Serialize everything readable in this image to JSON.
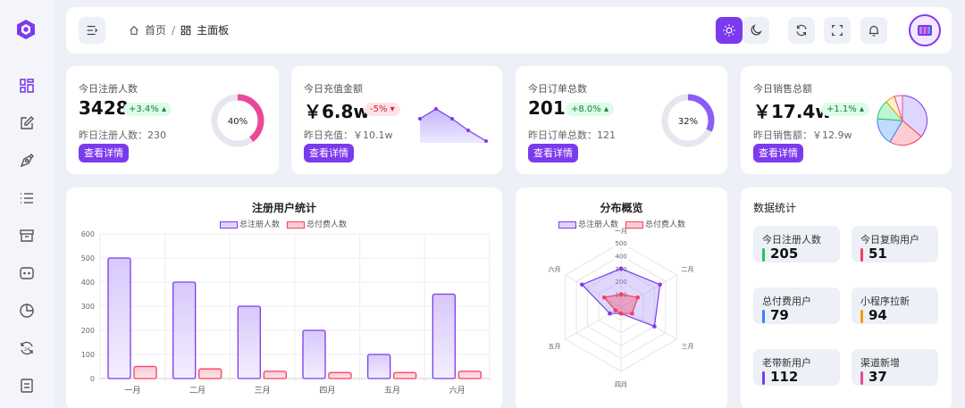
{
  "breadcrumb": {
    "home": "首页",
    "separator": "/",
    "current": "主面板"
  },
  "sidebar": {
    "items": [
      {
        "icon": "dashboard-icon"
      },
      {
        "icon": "edit-icon"
      },
      {
        "icon": "pen-icon"
      },
      {
        "icon": "list-icon"
      },
      {
        "icon": "archive-icon"
      },
      {
        "icon": "chat-icon"
      },
      {
        "icon": "pie-icon"
      },
      {
        "icon": "refresh24-icon"
      },
      {
        "icon": "document-icon"
      }
    ]
  },
  "colors": {
    "primary": "#7c3aed",
    "pink": "#f43f5e",
    "green": "#22c55e",
    "blue": "#3b82f6",
    "yellow": "#f59e0b"
  },
  "stats": [
    {
      "title": "今日注册人数",
      "value": "3428",
      "badge": "+3.4%",
      "badge_type": "up",
      "sub": "昨日注册人数：230",
      "button": "查看详情",
      "ring_label": "40%",
      "ring_percent": 40
    },
    {
      "title": "今日充值金额",
      "value": "￥6.8w",
      "badge": "-5%",
      "badge_type": "down",
      "sub": "昨日充值：￥10.1w",
      "button": "查看详情"
    },
    {
      "title": "今日订单总数",
      "value": "201",
      "badge": "+8.0%",
      "badge_type": "up",
      "sub": "昨日订单总数：121",
      "button": "查看详情",
      "ring_label": "32%",
      "ring_percent": 32
    },
    {
      "title": "今日销售总额",
      "value": "￥17.4w",
      "badge": "+1.1%",
      "badge_type": "up",
      "sub": "昨日销售额：￥12.9w",
      "button": "查看详情"
    }
  ],
  "chart_data": [
    {
      "type": "bar",
      "title": "注册用户统计",
      "categories": [
        "一月",
        "二月",
        "三月",
        "四月",
        "五月",
        "六月"
      ],
      "series": [
        {
          "name": "总注册人数",
          "values": [
            500,
            400,
            300,
            200,
            100,
            350
          ],
          "color": "#7c3aed"
        },
        {
          "name": "总付费人数",
          "values": [
            50,
            40,
            30,
            25,
            25,
            30
          ],
          "color": "#f43f5e"
        }
      ],
      "ylim": [
        0,
        600
      ],
      "yticks": [
        0,
        100,
        200,
        300,
        400,
        500,
        600
      ],
      "grid": true,
      "legend": "top"
    },
    {
      "type": "radar",
      "title": "分布概览",
      "axes": [
        "一月",
        "二月",
        "三月",
        "四月",
        "五月",
        "六月"
      ],
      "series": [
        {
          "name": "总注册人数",
          "values": [
            300,
            350,
            300,
            50,
            100,
            350
          ],
          "color": "#7c3aed"
        },
        {
          "name": "总付费人数",
          "values": [
            100,
            150,
            100,
            50,
            50,
            150
          ],
          "color": "#f43f5e"
        }
      ],
      "rlim": [
        0,
        500
      ],
      "rticks": [
        100,
        200,
        300,
        400,
        500
      ],
      "legend": "top"
    }
  ],
  "data_stats": {
    "title": "数据统计",
    "tiles": [
      {
        "label": "今日注册人数",
        "value": "205",
        "color": "#22c55e"
      },
      {
        "label": "今日复购用户",
        "value": "51",
        "color": "#f43f5e"
      },
      {
        "label": "总付费用户",
        "value": "79",
        "color": "#3b82f6"
      },
      {
        "label": "小程序拉新",
        "value": "94",
        "color": "#f59e0b"
      },
      {
        "label": "老带新用户",
        "value": "112",
        "color": "#7c3aed"
      },
      {
        "label": "渠道新增",
        "value": "37",
        "color": "#ec4899"
      }
    ]
  }
}
